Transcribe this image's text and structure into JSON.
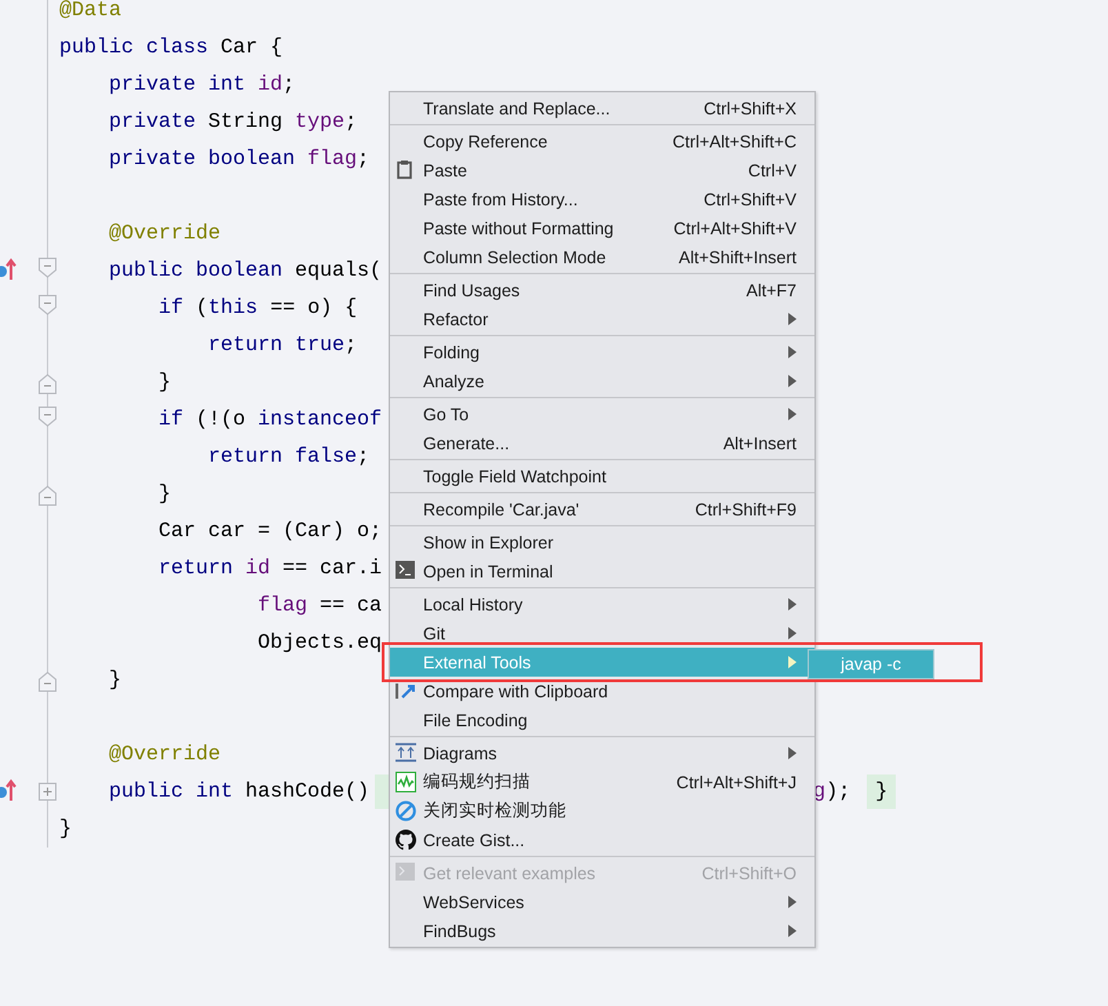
{
  "editor": {
    "lines": [
      {
        "kind": "code",
        "tokens": [
          {
            "text": "@Data",
            "kind": "annotation"
          }
        ]
      },
      {
        "kind": "code",
        "tokens": [
          {
            "text": "public class ",
            "kind": "keyword"
          },
          {
            "text": "Car {",
            "kind": "plain"
          }
        ]
      },
      {
        "kind": "code",
        "tokens": [
          {
            "text": "    private int ",
            "kind": "keyword"
          },
          {
            "text": "id",
            "kind": "field"
          },
          {
            "text": ";",
            "kind": "plain"
          }
        ]
      },
      {
        "kind": "code",
        "tokens": [
          {
            "text": "    private ",
            "kind": "keyword"
          },
          {
            "text": "String ",
            "kind": "plain"
          },
          {
            "text": "type",
            "kind": "field"
          },
          {
            "text": ";",
            "kind": "plain"
          }
        ]
      },
      {
        "kind": "code",
        "tokens": [
          {
            "text": "    private boolean ",
            "kind": "keyword"
          },
          {
            "text": "flag",
            "kind": "field"
          },
          {
            "text": ";",
            "kind": "plain"
          }
        ]
      },
      {
        "kind": "blank"
      },
      {
        "kind": "code",
        "tokens": [
          {
            "text": "    @Override",
            "kind": "annotation"
          }
        ]
      },
      {
        "kind": "code",
        "fold_start": true,
        "override": true,
        "tokens": [
          {
            "text": "    public boolean ",
            "kind": "keyword"
          },
          {
            "text": "equals(",
            "kind": "plain"
          }
        ]
      },
      {
        "kind": "code",
        "fold_start": true,
        "tokens": [
          {
            "text": "        if ",
            "kind": "keyword"
          },
          {
            "text": "(",
            "kind": "plain"
          },
          {
            "text": "this ",
            "kind": "keyword"
          },
          {
            "text": "== o) {",
            "kind": "plain"
          }
        ]
      },
      {
        "kind": "code",
        "tokens": [
          {
            "text": "            return true",
            "kind": "keyword"
          },
          {
            "text": ";",
            "kind": "plain"
          }
        ]
      },
      {
        "kind": "code",
        "fold_end": true,
        "tokens": [
          {
            "text": "        }",
            "kind": "plain"
          }
        ]
      },
      {
        "kind": "code",
        "fold_start": true,
        "tokens": [
          {
            "text": "        if ",
            "kind": "keyword"
          },
          {
            "text": "(!(o ",
            "kind": "plain"
          },
          {
            "text": "instanceof",
            "kind": "keyword"
          }
        ]
      },
      {
        "kind": "code",
        "tokens": [
          {
            "text": "            return false",
            "kind": "keyword"
          },
          {
            "text": ";",
            "kind": "plain"
          }
        ]
      },
      {
        "kind": "code",
        "fold_end": true,
        "tokens": [
          {
            "text": "        }",
            "kind": "plain"
          }
        ]
      },
      {
        "kind": "code",
        "tokens": [
          {
            "text": "        Car car = (Car) o;",
            "kind": "plain"
          }
        ]
      },
      {
        "kind": "code",
        "tokens": [
          {
            "text": "        return ",
            "kind": "keyword"
          },
          {
            "text": "id",
            "kind": "field"
          },
          {
            "text": " == car.i",
            "kind": "plain"
          }
        ]
      },
      {
        "kind": "code",
        "tokens": [
          {
            "text": "                flag",
            "kind": "field"
          },
          {
            "text": " == ca",
            "kind": "plain"
          }
        ]
      },
      {
        "kind": "code",
        "tokens": [
          {
            "text": "                Objects.eq",
            "kind": "plain"
          }
        ]
      },
      {
        "kind": "code",
        "fold_end": true,
        "tokens": [
          {
            "text": "    }",
            "kind": "plain"
          }
        ]
      },
      {
        "kind": "blank"
      },
      {
        "kind": "code",
        "tokens": [
          {
            "text": "    @Override",
            "kind": "annotation"
          }
        ]
      },
      {
        "kind": "code",
        "collapsed": true,
        "override": true,
        "tokens": [
          {
            "text": "    public int ",
            "kind": "keyword"
          },
          {
            "text": "hashCode()",
            "kind": "plain"
          }
        ],
        "tail": [
          {
            "text": "g",
            "kind": "field"
          },
          {
            "text": ");",
            "kind": "plain"
          }
        ],
        "closing": "}"
      },
      {
        "kind": "code",
        "tokens": [
          {
            "text": "}",
            "kind": "plain"
          }
        ]
      }
    ]
  },
  "context_menu": {
    "items": [
      {
        "kind": "item",
        "label": "Translate and Replace...",
        "shortcut": "Ctrl+Shift+X"
      },
      {
        "kind": "separator"
      },
      {
        "kind": "item",
        "label": "Copy Reference",
        "shortcut": "Ctrl+Alt+Shift+C"
      },
      {
        "kind": "item",
        "label": "Paste",
        "shortcut": "Ctrl+V"
      },
      {
        "kind": "item",
        "label": "Paste from History...",
        "shortcut": "Ctrl+Shift+V"
      },
      {
        "kind": "item",
        "label": "Paste without Formatting",
        "shortcut": "Ctrl+Alt+Shift+V"
      },
      {
        "kind": "item",
        "label": "Column Selection Mode",
        "shortcut": "Alt+Shift+Insert"
      },
      {
        "kind": "separator"
      },
      {
        "kind": "item",
        "label": "Find Usages",
        "shortcut": "Alt+F7"
      },
      {
        "kind": "item",
        "label": "Refactor",
        "submenu": true
      },
      {
        "kind": "separator"
      },
      {
        "kind": "item",
        "label": "Folding",
        "submenu": true
      },
      {
        "kind": "item",
        "label": "Analyze",
        "submenu": true
      },
      {
        "kind": "separator"
      },
      {
        "kind": "item",
        "label": "Go To",
        "submenu": true
      },
      {
        "kind": "item",
        "label": "Generate...",
        "shortcut": "Alt+Insert"
      },
      {
        "kind": "separator"
      },
      {
        "kind": "item",
        "label": "Toggle Field Watchpoint"
      },
      {
        "kind": "separator"
      },
      {
        "kind": "item",
        "label": "Recompile 'Car.java'",
        "shortcut": "Ctrl+Shift+F9"
      },
      {
        "kind": "separator"
      },
      {
        "kind": "item",
        "label": "Show in Explorer"
      },
      {
        "kind": "item",
        "label": "Open in Terminal"
      },
      {
        "kind": "separator"
      },
      {
        "kind": "item",
        "label": "Local History",
        "submenu": true
      },
      {
        "kind": "item",
        "label": "Git",
        "submenu": true
      },
      {
        "kind": "item",
        "label": "External Tools",
        "submenu": true,
        "selected": true
      },
      {
        "kind": "item",
        "label": "Compare with Clipboard"
      },
      {
        "kind": "item",
        "label": "File Encoding"
      },
      {
        "kind": "separator"
      },
      {
        "kind": "item",
        "label": "Diagrams",
        "submenu": true
      },
      {
        "kind": "item",
        "label": "编码规约扫描",
        "shortcut": "Ctrl+Alt+Shift+J"
      },
      {
        "kind": "item",
        "label": "关闭实时检测功能"
      },
      {
        "kind": "item",
        "label": "Create Gist..."
      },
      {
        "kind": "separator"
      },
      {
        "kind": "item",
        "label": "Get relevant examples",
        "shortcut": "Ctrl+Shift+O",
        "disabled": true
      },
      {
        "kind": "item",
        "label": "WebServices",
        "submenu": true
      },
      {
        "kind": "item",
        "label": "FindBugs",
        "submenu": true
      }
    ]
  },
  "submenu": {
    "items": [
      {
        "label": "javap -c",
        "selected": true
      }
    ]
  }
}
